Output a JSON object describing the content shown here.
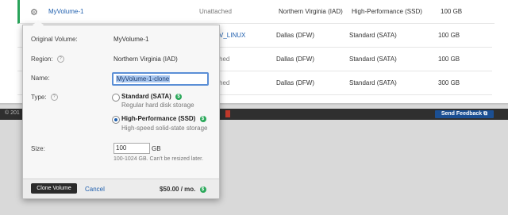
{
  "volumes": {
    "rows": [
      {
        "name": "MyVolume-1",
        "attached": "Unattached",
        "region": "Northern Virginia (IAD)",
        "type": "High-Performance (SSD)",
        "size": "100 GB"
      },
      {
        "name": "",
        "attached": "V_LINUX",
        "region": "Dallas (DFW)",
        "type": "Standard (SATA)",
        "size": "100 GB"
      },
      {
        "name": "",
        "attached": "hed",
        "region": "Dallas (DFW)",
        "type": "Standard (SATA)",
        "size": "100 GB"
      },
      {
        "name": "",
        "attached": "hed",
        "region": "Dallas (DFW)",
        "type": "Standard (SATA)",
        "size": "300 GB"
      }
    ]
  },
  "footer": {
    "copyright": "© 201",
    "feedback_label": "Send Feedback"
  },
  "clone_dialog": {
    "original_volume_label": "Original Volume:",
    "original_volume_value": "MyVolume-1",
    "region_label": "Region:",
    "region_value": "Northern Virginia (IAD)",
    "name_label": "Name:",
    "name_value": "MyVolume-1-clone",
    "type_label": "Type:",
    "options": [
      {
        "title": "Standard (SATA)",
        "desc": "Regular hard disk storage",
        "checked": false
      },
      {
        "title": "High-Performance (SSD)",
        "desc": "High-speed solid-state storage",
        "checked": true
      }
    ],
    "size_label": "Size:",
    "size_value": "100",
    "size_unit": "GB",
    "size_hint": "100-1024 GB. Can't be resized later.",
    "clone_button": "Clone Volume",
    "cancel_link": "Cancel",
    "price": "$50.00 / mo."
  },
  "icons": {
    "gear": "gear-icon",
    "help": "help-icon",
    "dollar": "dollar-icon",
    "feedback": "feedback-icon"
  },
  "colors": {
    "link": "#1f5fae",
    "accent_green": "#29a35a",
    "feedback_button": "#1b4f93"
  }
}
